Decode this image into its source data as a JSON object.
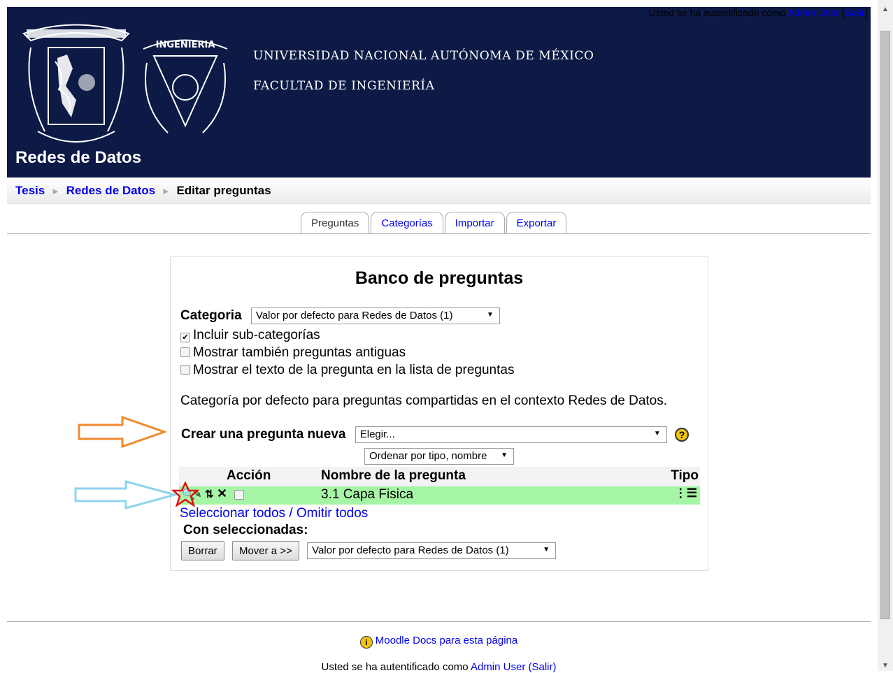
{
  "header": {
    "login_prefix": "Usted se ha autentificado como",
    "login_user": "Admin User",
    "logout": "Salir",
    "university": "UNIVERSIDAD NACIONAL AUTÓNOMA DE MÉXICO",
    "faculty": "FACULTAD DE INGENIERÍA",
    "course": "Redes de Datos",
    "logo_unam_icon": "unam-crest-icon",
    "logo_fi_icon": "fi-crest-icon",
    "fi_seal_text": "INGENIERIA",
    "bg_color": "#0d1a45"
  },
  "breadcrumb": {
    "items": [
      "Tesis",
      "Redes de Datos",
      "Editar preguntas"
    ],
    "separator": "►"
  },
  "tabs": [
    "Preguntas",
    "Categorías",
    "Importar",
    "Exportar"
  ],
  "main": {
    "title": "Banco de preguntas",
    "category_label": "Categoria",
    "category_value": "Valor por defecto para Redes de Datos (1)",
    "checkboxes": [
      {
        "label": "Incluir sub-categorías",
        "checked": true
      },
      {
        "label": "Mostrar también preguntas antiguas",
        "checked": false
      },
      {
        "label": "Mostrar el texto de la pregunta en la lista de preguntas",
        "checked": false
      }
    ],
    "category_info": "Categoría por defecto para preguntas compartidas en el contexto Redes de Datos.",
    "create_label": "Crear una pregunta nueva",
    "create_value": "Elegir...",
    "sort_value": "Ordenar por tipo, nombre",
    "table": {
      "headers": [
        "Acción",
        "Nombre de la pregunta",
        "Tipo"
      ],
      "rows": [
        {
          "name": "3.1 Capa Fisica",
          "row_color": "#a6f5a6"
        }
      ]
    },
    "select_all": "Seleccionar todos",
    "slash": "/",
    "deselect_all": "Omitir todos",
    "with_selected": "Con seleccionadas:",
    "delete_button": "Borrar",
    "move_button": "Mover a >>",
    "move_target": "Valor por defecto para Redes de Datos (1)"
  },
  "footer": {
    "docs_link": "Moodle Docs para esta página",
    "login_prefix": "Usted se ha autentificado como",
    "login_user": "Admin User",
    "logout": "(Salir)"
  },
  "annotations": {
    "orange_arrow_color": "#f08a2c",
    "blue_arrow_color": "#8fd4ec",
    "star_color": "#e01010"
  }
}
